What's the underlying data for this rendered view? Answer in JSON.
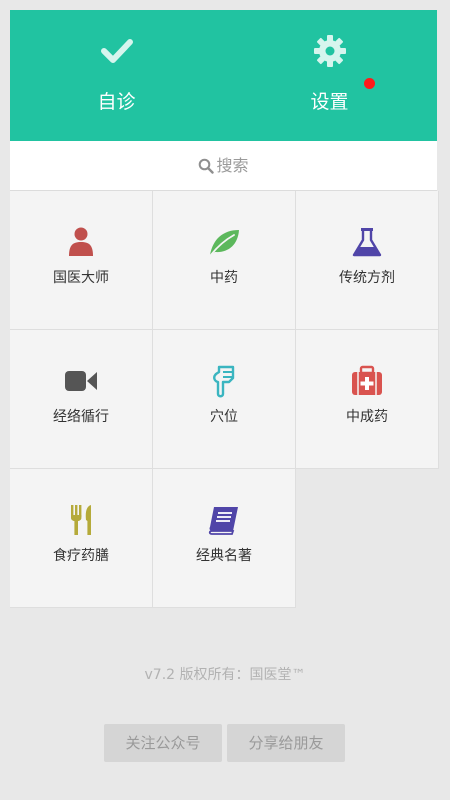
{
  "colors": {
    "accent": "#21c3a1",
    "badge": "#ff1a1a",
    "background": "#e8e8e8",
    "cell_background": "#f4f4f4"
  },
  "header": {
    "self_diagnosis": {
      "label": "自诊",
      "icon": "checkmark-icon"
    },
    "settings": {
      "label": "设置",
      "icon": "gear-icon",
      "has_notification": true
    }
  },
  "search": {
    "label": "搜索",
    "icon": "search-icon"
  },
  "grid": {
    "items": [
      {
        "label": "国医大师",
        "icon": "person-icon",
        "color": "#c0504d"
      },
      {
        "label": "中药",
        "icon": "leaf-icon",
        "color": "#5cb85c"
      },
      {
        "label": "传统方剂",
        "icon": "flask-icon",
        "color": "#5045a8"
      },
      {
        "label": "经络循行",
        "icon": "video-camera-icon",
        "color": "#555555"
      },
      {
        "label": "穴位",
        "icon": "pointing-hand-icon",
        "color": "#3ab5c0"
      },
      {
        "label": "中成药",
        "icon": "medical-kit-icon",
        "color": "#d9534f"
      },
      {
        "label": "食疗药膳",
        "icon": "fork-knife-icon",
        "color": "#b5aa3a"
      },
      {
        "label": "经典名著",
        "icon": "book-icon",
        "color": "#5045a8"
      }
    ]
  },
  "footer": {
    "copyright": "v7.2 版权所有：国医堂™",
    "follow_label": "关注公众号",
    "share_label": "分享给朋友"
  }
}
